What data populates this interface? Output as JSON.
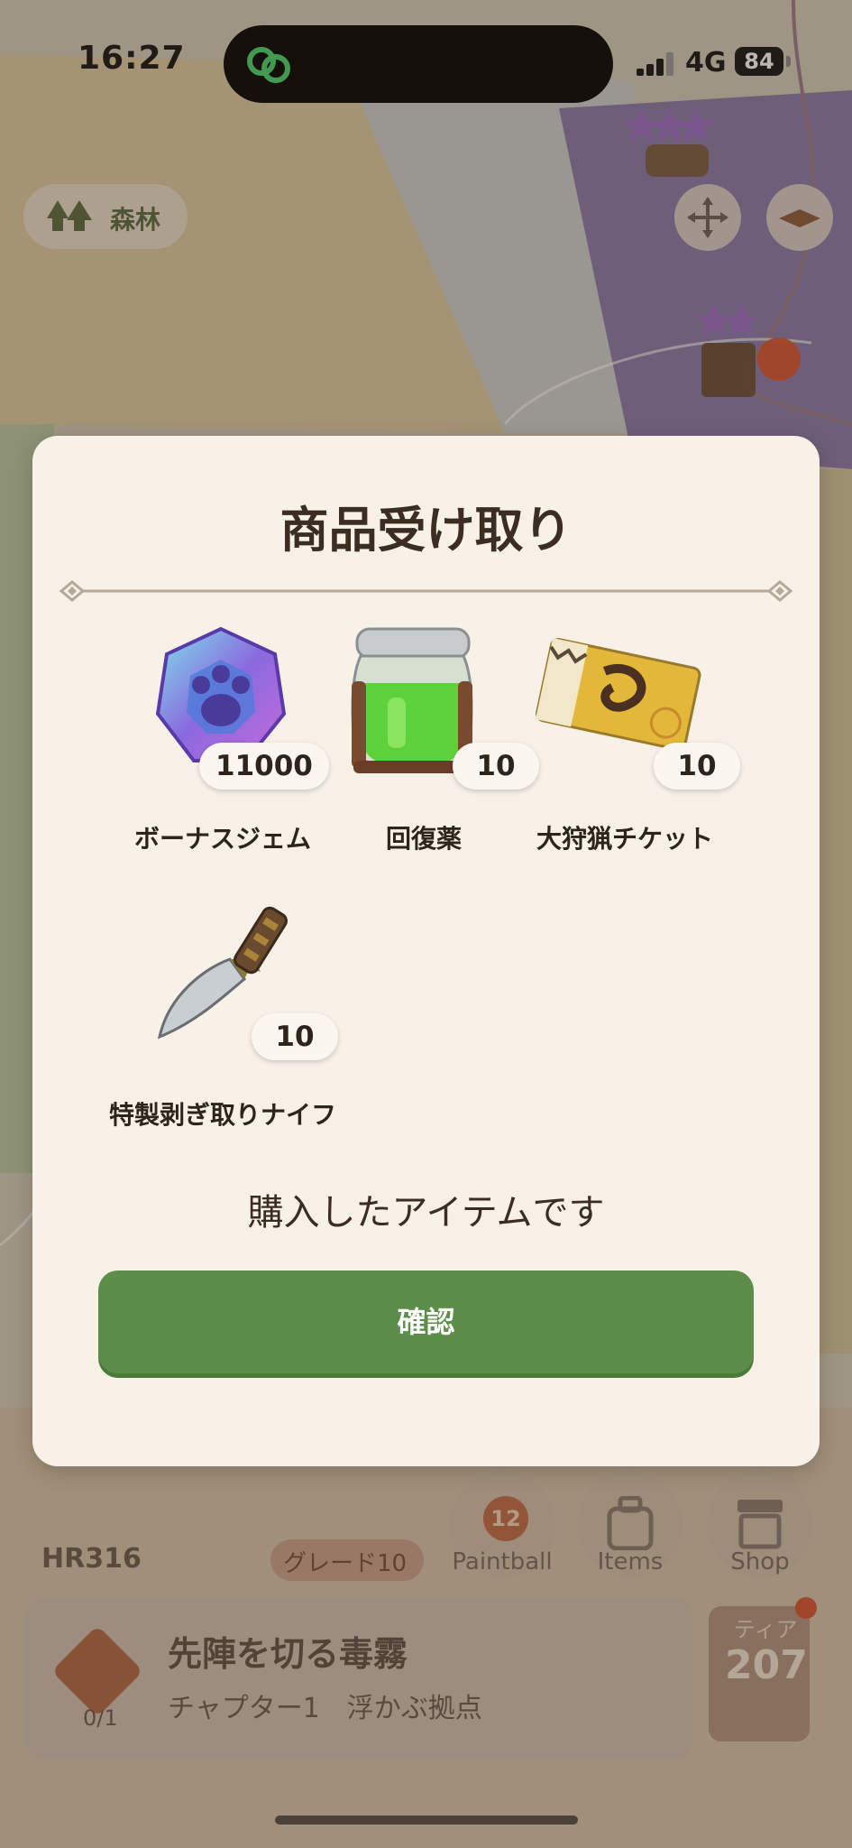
{
  "status_bar": {
    "time": "16:27",
    "network": "4G",
    "battery": "84"
  },
  "map": {
    "region_label": "森林",
    "hud": {
      "hunter_rank": "HR316",
      "grade": "グレード10",
      "paintball_count": "12",
      "paintball_label": "Paintball",
      "items_label": "Items",
      "shop_label": "Shop",
      "quest_title": "先陣を切る毒霧",
      "quest_subtitle": "チャプター1　浮かぶ拠点",
      "quest_progress": "0/1",
      "tier_label": "ティア",
      "tier_value": "207"
    }
  },
  "modal": {
    "title": "商品受け取り",
    "items": [
      {
        "name": "ボーナスジェム",
        "quantity": "11000",
        "icon": "bonus-gem-icon"
      },
      {
        "name": "回復薬",
        "quantity": "10",
        "icon": "potion-jar-icon"
      },
      {
        "name": "大狩猟チケット",
        "quantity": "10",
        "icon": "hunt-ticket-icon"
      },
      {
        "name": "特製剥ぎ取りナイフ",
        "quantity": "10",
        "icon": "carving-knife-icon"
      }
    ],
    "message": "購入したアイテムです",
    "confirm_label": "確認"
  },
  "colors": {
    "modal_bg": "#f7f1e8",
    "confirm_button": "#5c8e4a",
    "title_text": "#3b2d22"
  }
}
